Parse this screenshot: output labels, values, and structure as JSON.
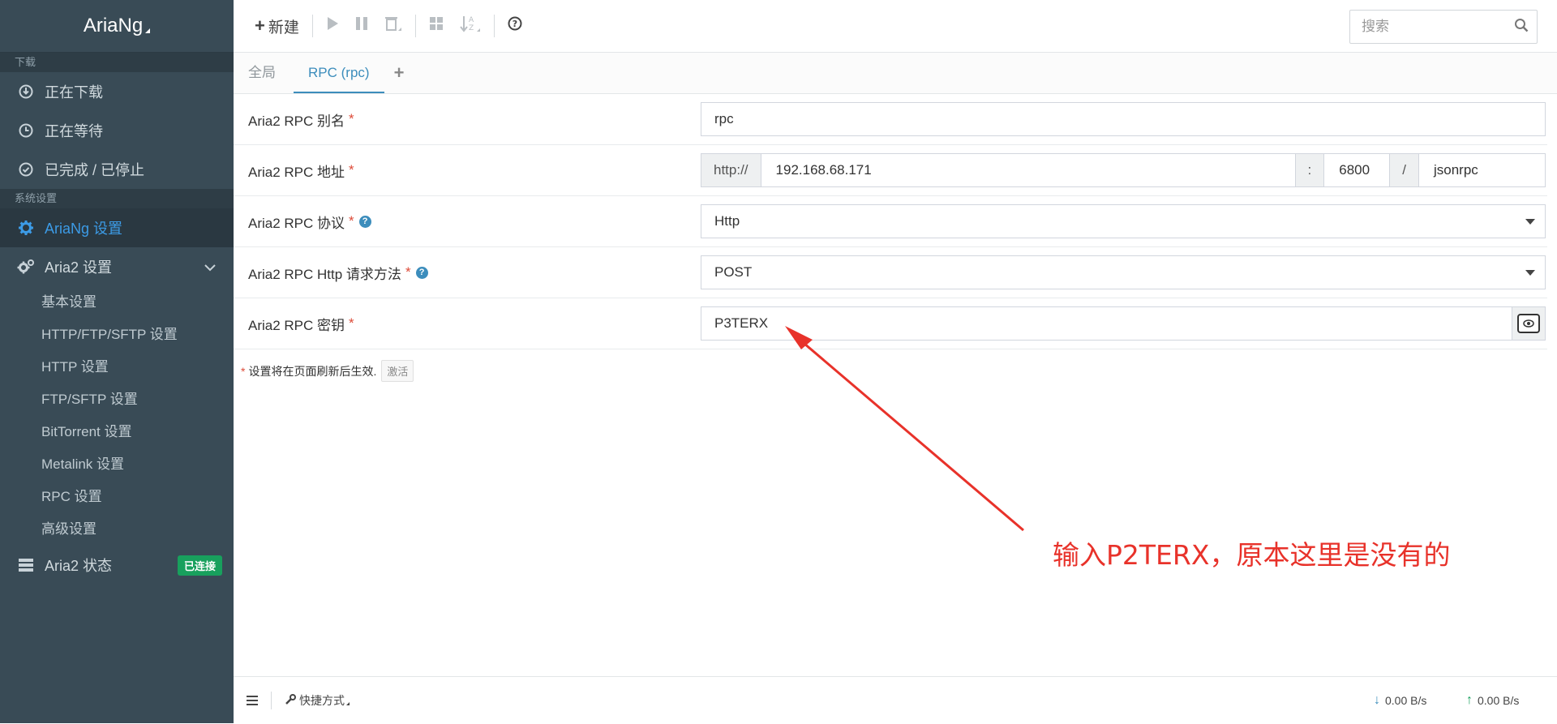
{
  "app": {
    "title": "AriaNg"
  },
  "sidebar": {
    "section_download": "下载",
    "downloading": "正在下载",
    "waiting": "正在等待",
    "stopped": "已完成 / 已停止",
    "section_settings": "系统设置",
    "ariang_settings": "AriaNg 设置",
    "aria2_settings": "Aria2 设置",
    "aria2_sub": [
      "基本设置",
      "HTTP/FTP/SFTP 设置",
      "HTTP 设置",
      "FTP/SFTP 设置",
      "BitTorrent 设置",
      "Metalink 设置",
      "RPC 设置",
      "高级设置"
    ],
    "aria2_status": "Aria2 状态",
    "status_badge": "已连接"
  },
  "toolbar": {
    "new_label": "新建",
    "search_placeholder": "搜索"
  },
  "tabs": {
    "global": "全局",
    "rpc": "RPC (rpc)"
  },
  "settings": {
    "alias_label": "Aria2 RPC 别名",
    "alias_value": "rpc",
    "address_label": "Aria2 RPC 地址",
    "address_protocol": "http://",
    "address_host": "192.168.68.171",
    "address_colon": ":",
    "address_port": "6800",
    "address_slash": "/",
    "address_path": "jsonrpc",
    "protocol_label": "Aria2 RPC 协议",
    "protocol_value": "Http",
    "method_label": "Aria2 RPC Http 请求方法",
    "method_value": "POST",
    "secret_label": "Aria2 RPC 密钥",
    "secret_value": "P3TERX",
    "required_mark": "*",
    "help_mark": "?"
  },
  "note": {
    "text": "设置将在页面刷新后生效.",
    "activate_button": "激活"
  },
  "annotation": {
    "text": "输入P2TERX，原本这里是没有的",
    "color": "#e8322a"
  },
  "footer": {
    "shortcut_label": "快捷方式",
    "download_speed": "0.00 B/s",
    "upload_speed": "0.00 B/s"
  },
  "colors": {
    "sidebar_bg": "#394b56",
    "accent": "#3c8dbc",
    "badge": "#18a05d",
    "required": "#dd4b39"
  }
}
